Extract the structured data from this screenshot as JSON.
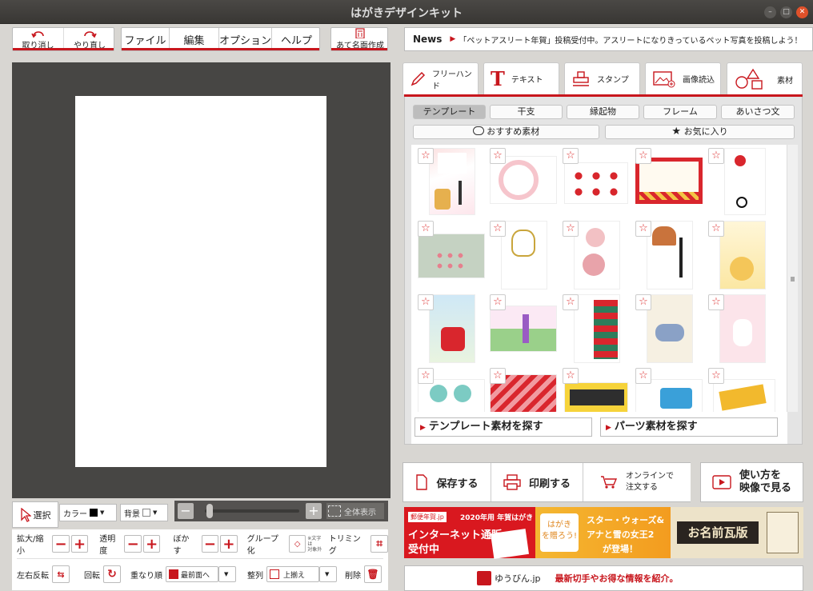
{
  "window": {
    "title": "はがきデザインキット"
  },
  "toolbar": {
    "undo": "取り消し",
    "redo": "やり直し",
    "menus": [
      "ファイル",
      "編集",
      "オプション",
      "ヘルプ"
    ],
    "address": "あて名面作成"
  },
  "news": {
    "label": "News",
    "text": "「ペットアスリート年賀」投稿受付中。アスリートになりきっているペット写真を投稿しよう！"
  },
  "tools": [
    {
      "label": "フリーハンド",
      "icon": "pencil-icon"
    },
    {
      "label": "テキスト",
      "icon": "text-t-icon"
    },
    {
      "label": "スタンプ",
      "icon": "stamp-icon"
    },
    {
      "label": "画像読込",
      "icon": "image-load-icon"
    },
    {
      "label": "素材",
      "icon": "shapes-icon"
    }
  ],
  "categories": [
    "テンプレート",
    "干支",
    "縁起物",
    "フレーム",
    "あいさつ文"
  ],
  "subcats": {
    "recommended": "おすすめ素材",
    "favorites": "お気に入り"
  },
  "find": {
    "template": "テンプレート素材を探す",
    "parts": "パーツ素材を探す"
  },
  "actions": {
    "save": "保存する",
    "print": "印刷する",
    "online": "オンラインで\n注文する",
    "howto": "使い方を\n映像で見る"
  },
  "bottom_left": {
    "select": "選択",
    "color": "カラー",
    "background": "背景",
    "fit": "全体表示"
  },
  "props": {
    "scale": "拡大/縮小",
    "opacity": "透明度",
    "blur": "ぼかす",
    "group": "グループ化",
    "group_note": "※文字は\n対象外",
    "trim": "トリミング",
    "flip": "左右反転",
    "rotate": "回転",
    "order": "重なり順",
    "order_value": "最前面へ",
    "align": "整列",
    "align_value": "上揃え",
    "delete": "削除"
  },
  "ads": {
    "badge": "郵便年賀.jp",
    "year": "2020年用 年賀はがき",
    "line1": "インターネット通販",
    "line2": "受付中",
    "mid_title": "スター・ウォーズ&",
    "mid_sub": "アナと雪の女王2",
    "mid_tail": "が登場！",
    "mid_left": "はがき",
    "mid_left2": "を贈ろう!",
    "right": "お名前瓦版"
  },
  "yubin": {
    "label": "ゆうびん.jp",
    "text": "最新切手やお得な情報を紹介。"
  },
  "colors": {
    "accent": "#c8161d"
  }
}
